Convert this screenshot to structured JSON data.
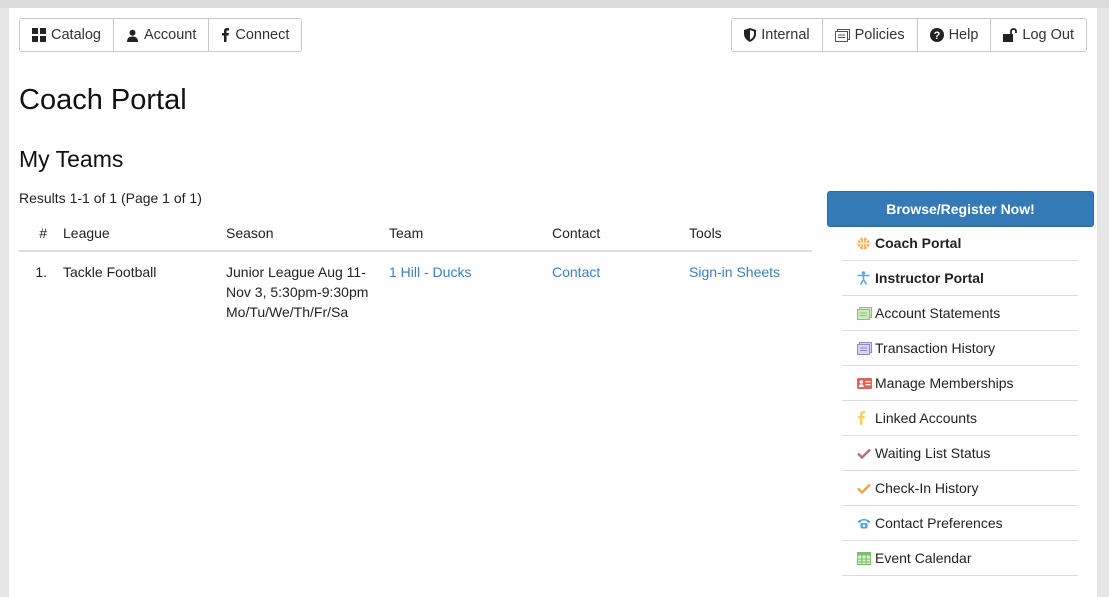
{
  "nav_left": [
    {
      "label": "Catalog",
      "icon": "grid-icon"
    },
    {
      "label": "Account",
      "icon": "user-icon"
    },
    {
      "label": "Connect",
      "icon": "facebook-icon"
    }
  ],
  "nav_right": [
    {
      "label": "Internal",
      "icon": "shield-icon"
    },
    {
      "label": "Policies",
      "icon": "document-icon"
    },
    {
      "label": "Help",
      "icon": "question-icon"
    },
    {
      "label": "Log Out",
      "icon": "unlock-icon"
    }
  ],
  "page_title": "Coach Portal",
  "section_title": "My Teams",
  "results_text": "Results 1-1 of 1 (Page 1 of 1)",
  "table": {
    "headers": [
      "#",
      "League",
      "Season",
      "Team",
      "Contact",
      "Tools"
    ],
    "rows": [
      {
        "num": "1.",
        "league": "Tackle Football",
        "season_line1": "Junior League Aug 11-",
        "season_line2": "Nov 3, 5:30pm-9:30pm",
        "season_line3": "Mo/Tu/We/Th/Fr/Sa",
        "team": "1 Hill - Ducks",
        "contact": "Contact",
        "tools": "Sign-in Sheets"
      }
    ]
  },
  "browse_button": "Browse/Register Now!",
  "sidebar": [
    {
      "label": "Coach Portal",
      "icon": "basketball-icon",
      "bold": true
    },
    {
      "label": "Instructor Portal",
      "icon": "person-icon",
      "bold": true
    },
    {
      "label": "Account Statements",
      "icon": "statement-icon"
    },
    {
      "label": "Transaction History",
      "icon": "receipt-icon"
    },
    {
      "label": "Manage Memberships",
      "icon": "id-card-icon"
    },
    {
      "label": "Linked Accounts",
      "icon": "facebook-icon"
    },
    {
      "label": "Waiting List Status",
      "icon": "check-icon"
    },
    {
      "label": "Check-In History",
      "icon": "check-icon"
    },
    {
      "label": "Contact Preferences",
      "icon": "phone-icon"
    },
    {
      "label": "Event Calendar",
      "icon": "calendar-icon"
    }
  ],
  "colors": {
    "link": "#3a7fc1",
    "primary_button": "#337ab7"
  }
}
